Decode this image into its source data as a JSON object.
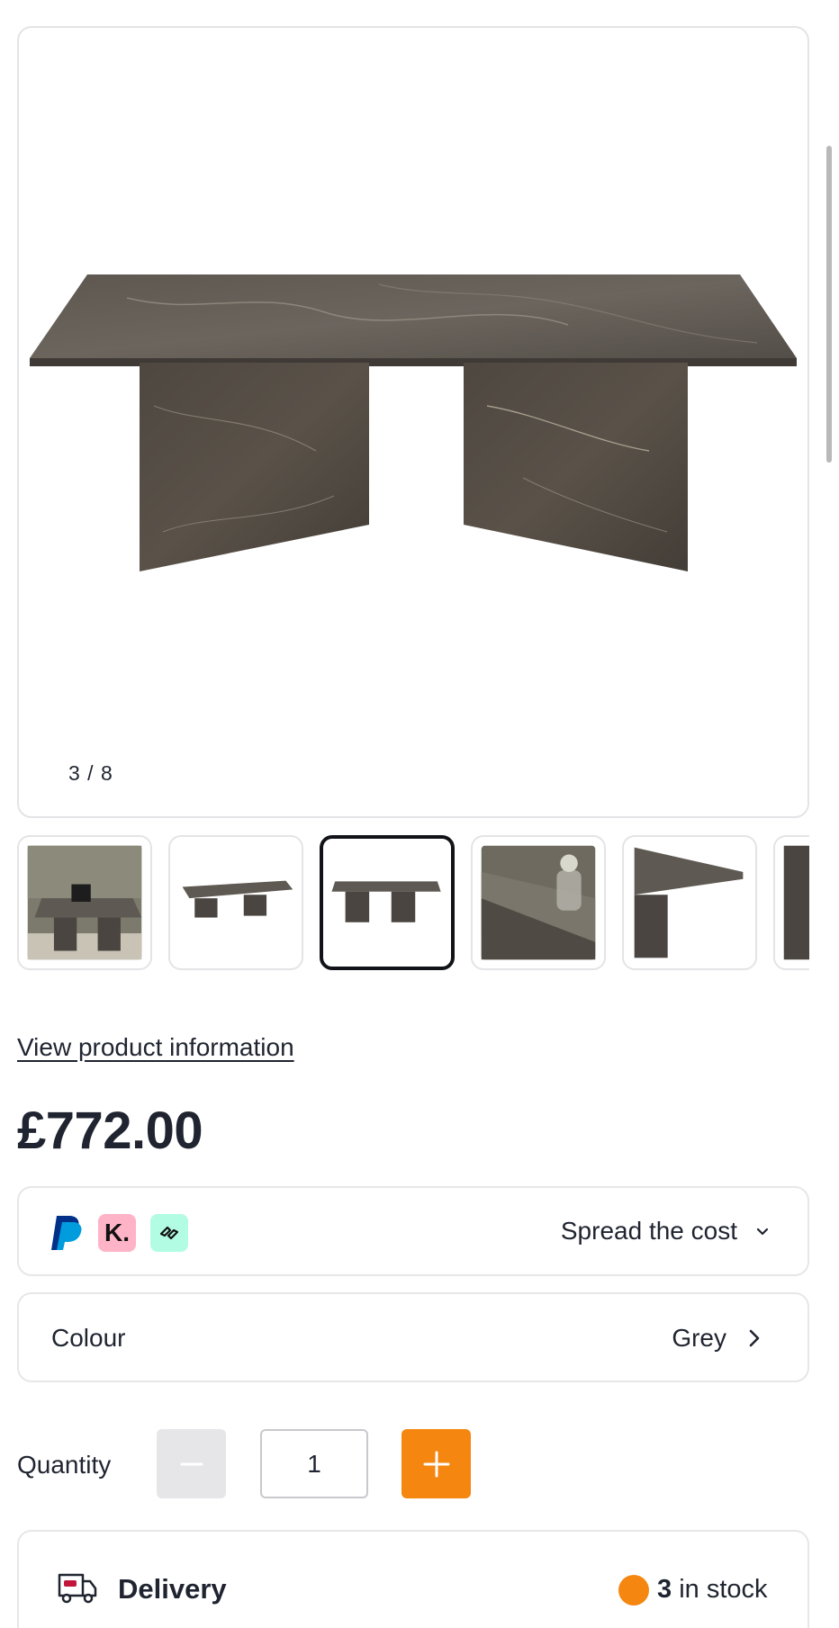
{
  "gallery": {
    "counter": "3 / 8",
    "current_image": 3,
    "total_images": 8,
    "thumbnails": [
      {
        "name": "lifestyle-room"
      },
      {
        "name": "table-angle"
      },
      {
        "name": "table-front",
        "active": true
      },
      {
        "name": "table-closeup-vase"
      },
      {
        "name": "table-corner-detail"
      },
      {
        "name": "table-partial"
      }
    ]
  },
  "product": {
    "info_link": "View product information",
    "price": "£772.00"
  },
  "payment": {
    "providers": [
      "paypal-icon",
      "klarna-icon",
      "clearpay-icon"
    ],
    "klarna_letter": "K.",
    "spread_label": "Spread the cost"
  },
  "variant": {
    "label": "Colour",
    "value": "Grey"
  },
  "quantity": {
    "label": "Quantity",
    "value": "1"
  },
  "delivery": {
    "label": "Delivery",
    "stock_count": "3",
    "stock_suffix": " in stock"
  },
  "colors": {
    "accent": "#f5860f",
    "text": "#1f2430",
    "border": "#e4e4e7",
    "klarna_bg": "#ffb3c7",
    "clearpay_bg": "#b2fce4",
    "paypal_dark": "#003087",
    "paypal_light": "#009cde"
  }
}
